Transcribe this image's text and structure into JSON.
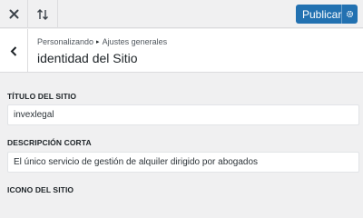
{
  "topbar": {
    "close_icon": "close-icon",
    "reorder_icon": "reorder-icon",
    "publish_label": "Publicar",
    "publish_gear_icon": "gear-icon",
    "accent": "#2271b1"
  },
  "header": {
    "breadcrumb_root": "Personalizando",
    "breadcrumb_section": "Ajustes generales",
    "title": "identidad del Sitio"
  },
  "fields": {
    "site_title_label": "TÍTULO DEL SITIO",
    "site_title_value": "invexlegal",
    "tagline_label": "DESCRIPCIÓN CORTA",
    "tagline_value": "El único servicio de gestión de alquiler dirigido por abogados",
    "site_icon_label": "ICONO DEL SITIO"
  }
}
